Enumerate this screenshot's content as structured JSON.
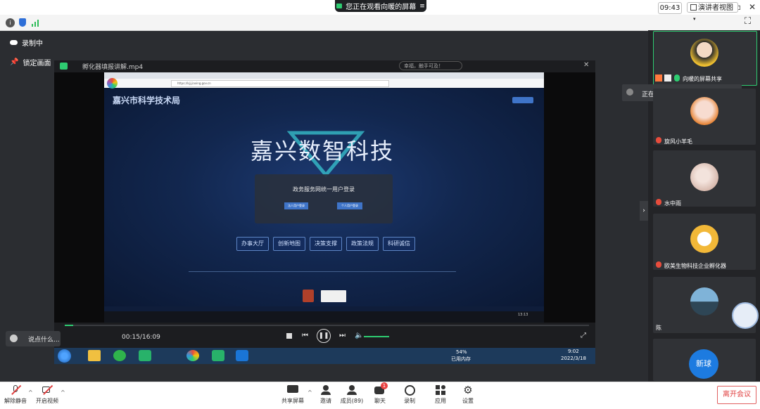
{
  "titlebar": {
    "share_status": "您正在观看向暖的屏幕"
  },
  "infobar": {
    "clock": "09:43",
    "view_mode": "演讲者视图"
  },
  "left_overlay": {
    "recording": "录制中",
    "lock_screen": "锁定画面",
    "say_something": "说点什么..."
  },
  "shared_screen": {
    "player_title": "孵化器填报讲解.mp4",
    "player_search": "幸福，触手可及！",
    "browser_url": "https://kjj.jiaxing.gov.cn",
    "site_header": "嘉兴市科学技术局",
    "hero_title": "嘉兴数智科技",
    "modal_title": "政务服务网统一用户登录",
    "modal_btn_legal": "法人用户登录",
    "modal_btn_person": "个人用户登录",
    "services": [
      "办事大厅",
      "创新地图",
      "决策支撑",
      "政策法规",
      "科研诚信"
    ],
    "time_display": "00:15/16:09",
    "inner_clock": "13:13",
    "taskbar_time": "9:02",
    "taskbar_date": "2022/3/18",
    "memory": "54%",
    "memory_label": "已用内存"
  },
  "sidebar": {
    "active_speaker": "正在讲话: 向暖;",
    "participants": [
      {
        "name": "向暖的屏幕共享"
      },
      {
        "name": "旋风小羊毛"
      },
      {
        "name": "水中雨"
      },
      {
        "name": "欧美生物科技企业孵化器"
      },
      {
        "name": "陈"
      },
      {
        "name": "新球"
      }
    ]
  },
  "toolbar": {
    "unmute": "解除静音",
    "start_video": "开启视频",
    "share_screen": "共享屏幕",
    "invite": "邀请",
    "members": "成员(89)",
    "chat": "聊天",
    "chat_badge": "1",
    "record": "录制",
    "apps": "应用",
    "settings": "设置",
    "leave": "离开会议"
  }
}
